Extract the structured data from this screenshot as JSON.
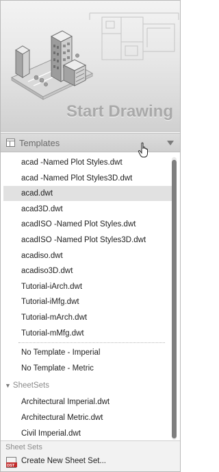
{
  "hero": {
    "title": "Start Drawing"
  },
  "templates_header": {
    "label": "Templates",
    "icon": "template-icon",
    "dropdown_icon": "triangle-down-icon"
  },
  "templates": [
    "acad -Named Plot Styles.dwt",
    "acad -Named Plot Styles3D.dwt",
    "acad.dwt",
    "acad3D.dwt",
    "acadISO -Named Plot Styles.dwt",
    "acadISO -Named Plot Styles3D.dwt",
    "acadiso.dwt",
    "acadiso3D.dwt",
    "Tutorial-iArch.dwt",
    "Tutorial-iMfg.dwt",
    "Tutorial-mArch.dwt",
    "Tutorial-mMfg.dwt"
  ],
  "selected_template": "acad.dwt",
  "no_template": [
    "No Template - Imperial",
    "No Template - Metric"
  ],
  "sheetsets_group": {
    "label": "SheetSets",
    "expanded": true
  },
  "sheetsets": [
    "Architectural Imperial.dwt",
    "Architectural Metric.dwt",
    "Civil Imperial.dwt"
  ],
  "footer": {
    "section_label": "Sheet Sets",
    "create_label": "Create New Sheet Set...",
    "create_icon_text": "DST"
  }
}
